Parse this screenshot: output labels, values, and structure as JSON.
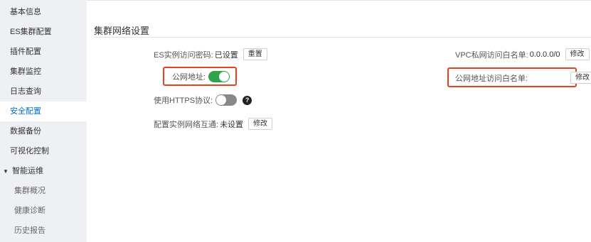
{
  "sidebar": {
    "items": [
      {
        "label": "基本信息"
      },
      {
        "label": "ES集群配置"
      },
      {
        "label": "插件配置"
      },
      {
        "label": "集群监控"
      },
      {
        "label": "日志查询"
      },
      {
        "label": "安全配置",
        "active": true
      },
      {
        "label": "数据备份"
      },
      {
        "label": "可视化控制"
      },
      {
        "label": "智能运维",
        "expanded": true
      },
      {
        "label": "集群概况"
      },
      {
        "label": "健康诊断"
      },
      {
        "label": "历史报告"
      }
    ]
  },
  "main": {
    "section_title": "集群网络设置",
    "es_password": {
      "label": "ES实例访问密码:",
      "value": "已设置",
      "button": "重置"
    },
    "public_address": {
      "label": "公网地址:",
      "enabled": true
    },
    "https": {
      "label": "使用HTTPS协议:",
      "enabled": false,
      "help_icon": "?"
    },
    "network_interconnect": {
      "label": "配置实例网络互通:",
      "value": "未设置",
      "button": "修改"
    },
    "vpc_whitelist": {
      "label": "VPC私网访问白名单:",
      "value": "0.0.0.0/0",
      "button": "修改"
    },
    "public_whitelist": {
      "label": "公网地址访问白名单:",
      "button": "修改"
    }
  },
  "colors": {
    "accent": "#0070cc",
    "toggle_on": "#2fa34b",
    "highlight_box": "#e8431f"
  }
}
